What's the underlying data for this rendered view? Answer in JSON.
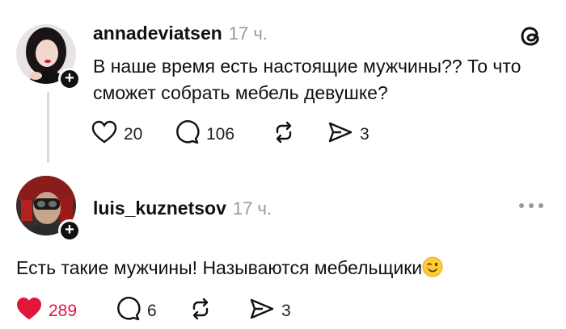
{
  "post1": {
    "username": "annadeviatsen",
    "time": "17 ч.",
    "text": "В наше время есть настоящие мужчины?? То что сможет собрать мебель девушке?",
    "likes": "20",
    "comments": "106",
    "shares": "3",
    "liked": false
  },
  "post2": {
    "username": "luis_kuznetsov",
    "time": "17 ч.",
    "text": "Есть такие мужчины! Называются мебельщики",
    "likes": "289",
    "comments": "6",
    "shares": "3",
    "liked": true
  },
  "colors": {
    "like_active": "#e0163a",
    "text": "#111111",
    "muted": "#9a9a9a",
    "thread_line": "#d9d9d9"
  },
  "icons": [
    "threads-logo-icon",
    "heart-icon",
    "comment-icon",
    "repost-icon",
    "share-icon",
    "more-icon",
    "plus-icon",
    "winking-face-emoji"
  ]
}
